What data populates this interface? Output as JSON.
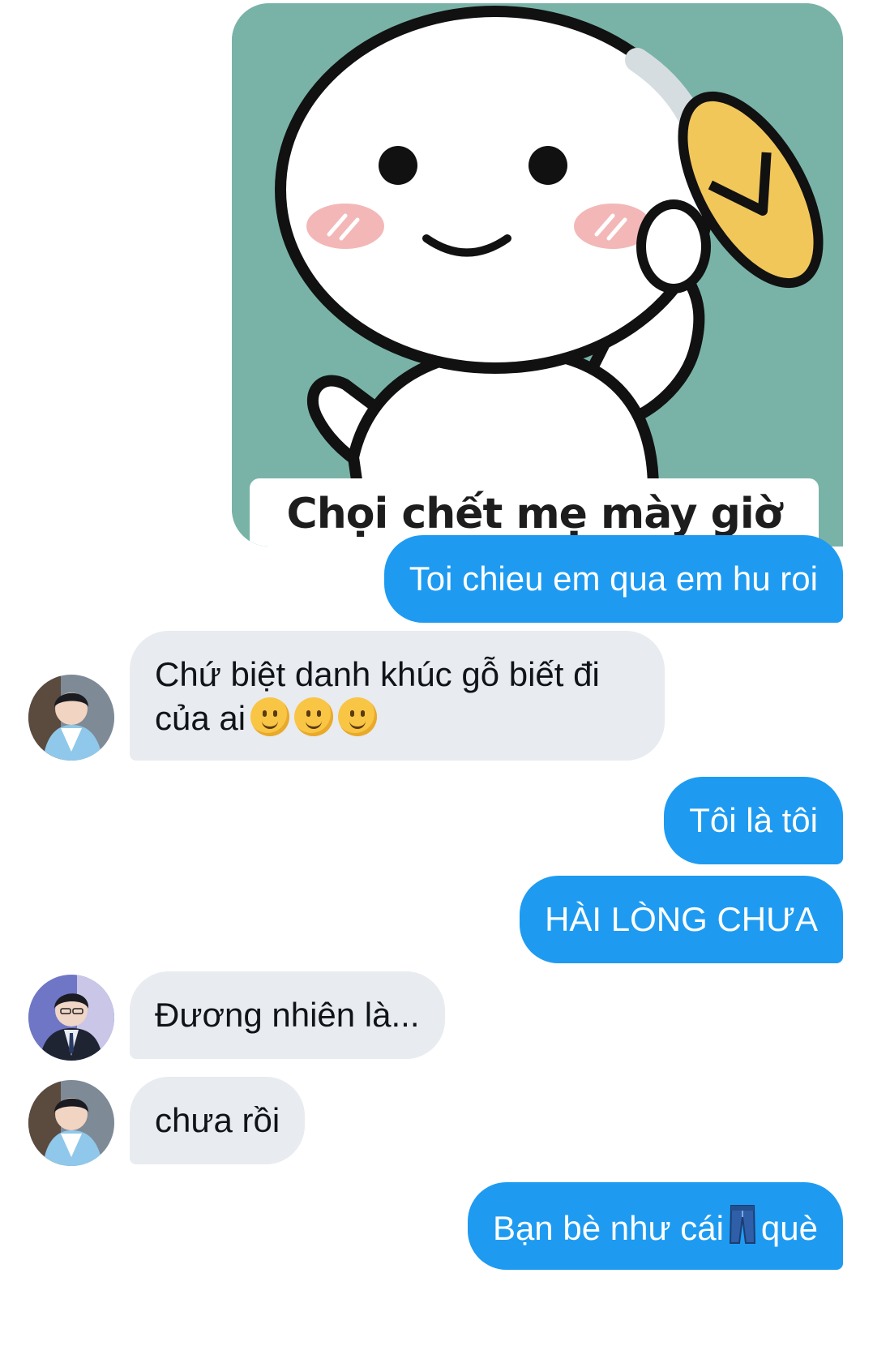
{
  "messages": [
    {
      "id": "m1",
      "from": "me",
      "type": "sticker",
      "caption": "Chọi chết mẹ mày giờ"
    },
    {
      "id": "m2",
      "from": "me",
      "type": "text",
      "text": "Toi chieu em qua em hu roi"
    },
    {
      "id": "m3",
      "from": "other",
      "type": "text",
      "line1": "Chứ biệt danh khúc gỗ biết đi",
      "line2": "của ai",
      "emojis": [
        "slightly-smiling-face",
        "slightly-smiling-face",
        "slightly-smiling-face"
      ],
      "avatar": "avatar-hanbok"
    },
    {
      "id": "m4",
      "from": "me",
      "type": "text",
      "text": "Tôi là tôi"
    },
    {
      "id": "m5",
      "from": "me",
      "type": "text",
      "text": "HÀI LÒNG CHƯA"
    },
    {
      "id": "m6",
      "from": "other",
      "type": "text",
      "text": "Đương nhiên là...",
      "avatar": "avatar-suit"
    },
    {
      "id": "m7",
      "from": "other",
      "type": "text",
      "text": "chưa rồi",
      "avatar": "avatar-hanbok"
    },
    {
      "id": "m8",
      "from": "me",
      "type": "text",
      "before": "Bạn bè như cái",
      "emoji": "jeans",
      "after": "què"
    }
  ],
  "colors": {
    "sent_bubble": "#1e9bf1",
    "received_bubble": "#e8ebef",
    "sticker_bg": "#79b3a7"
  }
}
